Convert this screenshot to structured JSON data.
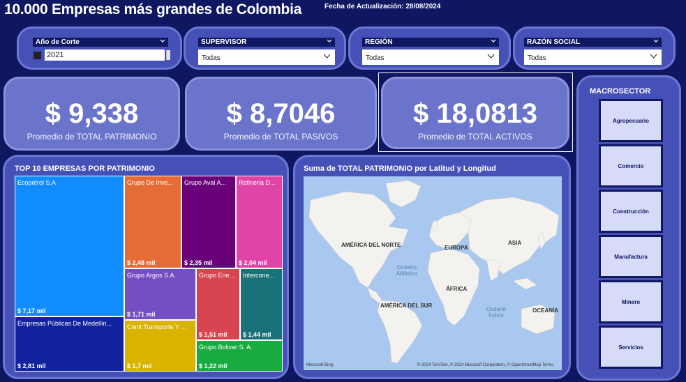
{
  "header": {
    "title": "10.000 Empresas más grandes de Colombia",
    "update_date": "Fecha de Actualización: 28/08/2024"
  },
  "filters": {
    "year": {
      "label": "Año de Corte",
      "value": "2021"
    },
    "supervisor": {
      "label": "SUPERVISOR",
      "value": "Todas"
    },
    "region": {
      "label": "REGIÓN",
      "value": "Todas"
    },
    "razon_social": {
      "label": "RAZÓN SOCIAL",
      "value": "Todas"
    }
  },
  "kpis": {
    "patrimonio": {
      "value": "$ 9,338",
      "label": "Promedio de TOTAL PATRIMONIO"
    },
    "pasivos": {
      "value": "$ 8,7046",
      "label": "Promedio de TOTAL PASIVOS"
    },
    "activos": {
      "value": "$ 18,0813",
      "label": "Promedio de TOTAL ACTIVOS"
    }
  },
  "macrosector": {
    "title": "MACROSECTOR",
    "items": [
      {
        "label": "Agropecuario"
      },
      {
        "label": "Comercio"
      },
      {
        "label": "Construcción"
      },
      {
        "label": "Manufactura"
      },
      {
        "label": "Minero"
      },
      {
        "label": "Servicios"
      }
    ]
  },
  "treemap": {
    "title": "TOP 10 EMPRESAS POR PATRIMONIO",
    "tiles": [
      {
        "name": "Ecopetrol S.A",
        "value": "$ 7,17 mil",
        "color": "#118dff"
      },
      {
        "name": "Empresas Públicas De Medellín...",
        "value": "$ 2,81 mil",
        "color": "#12239e"
      },
      {
        "name": "Grupo De Inve...",
        "value": "$ 2,48 mil",
        "color": "#e66c37"
      },
      {
        "name": "Grupo Aval A...",
        "value": "$ 2,35 mil",
        "color": "#6b007b"
      },
      {
        "name": "Refineria D...",
        "value": "$ 2,04 mil",
        "color": "#e044a7"
      },
      {
        "name": "Grupo Argos S.A.",
        "value": "$ 1,71 mil",
        "color": "#744ec2"
      },
      {
        "name": "Cenit Transporte Y ...",
        "value": "$ 1,7 mil",
        "color": "#d9b300"
      },
      {
        "name": "Grupo Ene...",
        "value": "$ 1,51 mil",
        "color": "#d64550"
      },
      {
        "name": "Intercone...",
        "value": "$ 1,44 mil",
        "color": "#197278"
      },
      {
        "name": "Grupo Bolivar S. A.",
        "value": "$ 1,22 mil",
        "color": "#1aab40"
      }
    ]
  },
  "map": {
    "title": "Suma de TOTAL PATRIMONIO por Latitud y Longitud",
    "labels": {
      "north_america": "AMÉRICA DEL NORTE",
      "europe": "EUROPA",
      "asia": "ASIA",
      "africa": "ÁFRICA",
      "south_america": "AMÉRICA DEL SUR",
      "oceania": "OCEANÍA"
    },
    "oceans": {
      "atlantic": "Océano Atlántico",
      "indian": "Océano Índico"
    },
    "attribution": "© 2024 TomTom, © 2024 Microsoft Corporation, © OpenStreetMap  Terms",
    "bing": "Microsoft Bing"
  },
  "colors": {
    "background": "#0f1760",
    "card": "#4651b8",
    "kpi_card": "#6a74cb"
  }
}
